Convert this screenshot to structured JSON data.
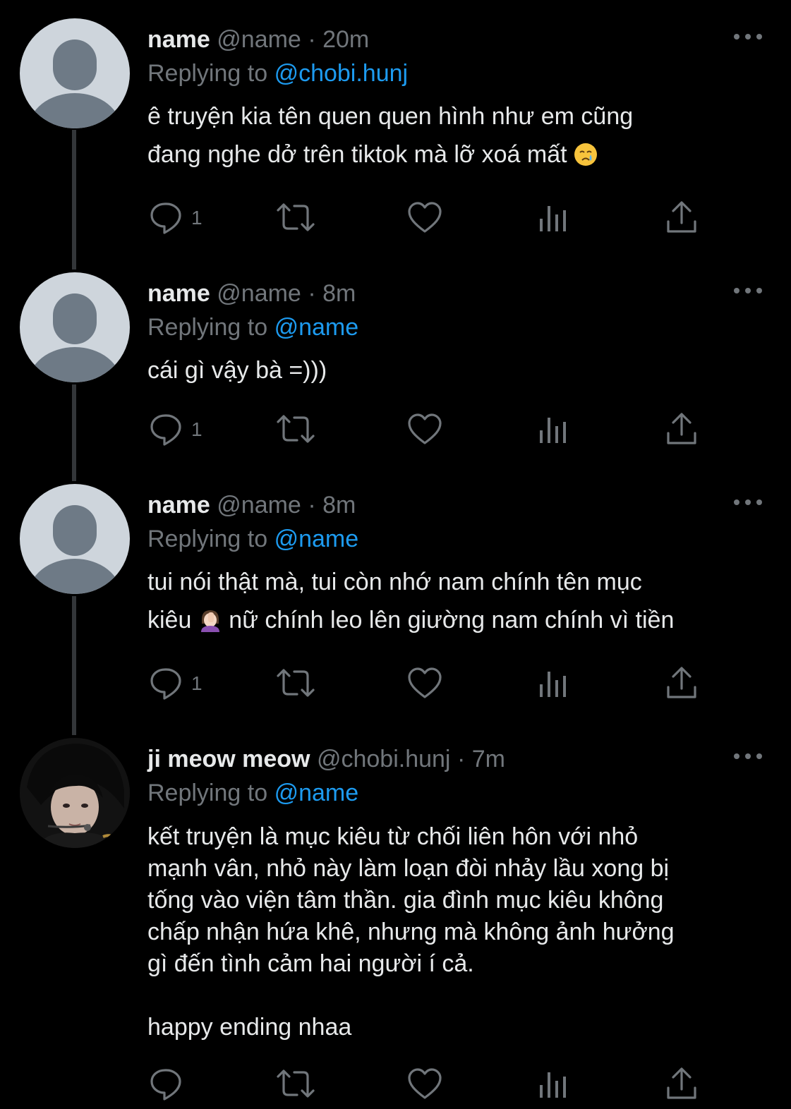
{
  "colors": {
    "background": "#000000",
    "text": "#e7e9ea",
    "muted": "#71767b",
    "link": "#1d9bf0",
    "avatar_placeholder": "#ced5dc",
    "avatar_silhouette": "#6e7a86"
  },
  "reply_prefix": "Replying to",
  "tweets": [
    {
      "name": "name",
      "handle": "@name",
      "dot": "·",
      "time": "20m",
      "reply_to": "@chobi.hunj",
      "line1": "ê truyện kia tên quen quen hình như em cũng",
      "line2": "đang nghe dở trên tiktok mà lỡ xoá mất",
      "emoji": "crying-face",
      "reply_count": "1"
    },
    {
      "name": "name",
      "handle": "@name",
      "dot": "·",
      "time": "8m",
      "reply_to": "@name",
      "line1": "cái gì vậy bà =)))",
      "reply_count": "1"
    },
    {
      "name": "name",
      "handle": "@name",
      "dot": "·",
      "time": "8m",
      "reply_to": "@name",
      "line1": "tui nói thật mà, tui còn nhớ nam chính tên mục",
      "line2a": "kiêu",
      "line2b": "nữ chính leo lên giường nam chính vì tiền",
      "emoji": "woman-facepalming",
      "reply_count": "1"
    },
    {
      "name": "ji meow meow",
      "handle": "@chobi.hunj",
      "dot": "·",
      "time": "7m",
      "reply_to": "@name",
      "lines": [
        "kết truyện là mục kiêu từ chối liên hôn với nhỏ",
        "mạnh vân, nhỏ này làm loạn đòi nhảy lầu xong bị",
        "tống vào viện tâm thần. gia đình mục kiêu không",
        "chấp nhận hứa khê, nhưng mà không ảnh hưởng",
        "gì đến tình cảm hai người í cả."
      ],
      "last_line": "happy ending nhaa"
    }
  ]
}
